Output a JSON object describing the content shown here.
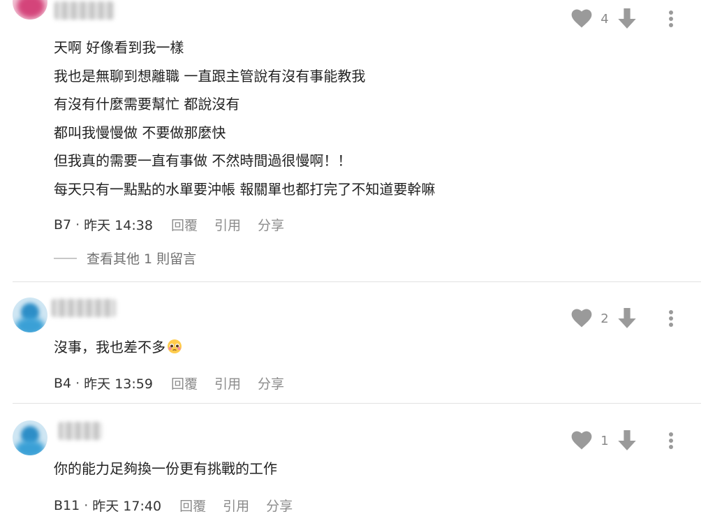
{
  "comments": [
    {
      "likes": "4",
      "lines": [
        "天啊 好像看到我一樣",
        "我也是無聊到想離職 一直跟主管說有沒有事能教我",
        "有沒有什麼需要幫忙 都說沒有",
        "都叫我慢慢做 不要做那麼快",
        "但我真的需要一直有事做 不然時間過很慢啊！！",
        "每天只有一點點的水單要沖帳 報關單也都打完了不知道要幹嘛"
      ],
      "floor": "B7",
      "time": "昨天 14:38",
      "reply_label": "回覆",
      "quote_label": "引用",
      "share_label": "分享",
      "view_more": "查看其他 1 則留言",
      "avatar_color": "#d4447a"
    },
    {
      "likes": "2",
      "lines": [
        "沒事，我也差不多"
      ],
      "floor": "B4",
      "time": "昨天 13:59",
      "reply_label": "回覆",
      "quote_label": "引用",
      "share_label": "分享",
      "avatar_color": "#3a9ad0"
    },
    {
      "likes": "1",
      "lines": [
        "你的能力足夠換一份更有挑戰的工作"
      ],
      "floor": "B11",
      "time": "昨天 17:40",
      "reply_label": "回覆",
      "quote_label": "引用",
      "share_label": "分享",
      "avatar_color": "#3a9ad0"
    }
  ],
  "icons": {
    "like": "heart-icon",
    "dislike": "arrow-down-icon",
    "more": "more-vertical-icon",
    "emoji": "pleading-face-emoji"
  },
  "colors": {
    "icon_gray": "#9a9a9a",
    "text": "#222222",
    "muted": "#8c8c8c"
  }
}
